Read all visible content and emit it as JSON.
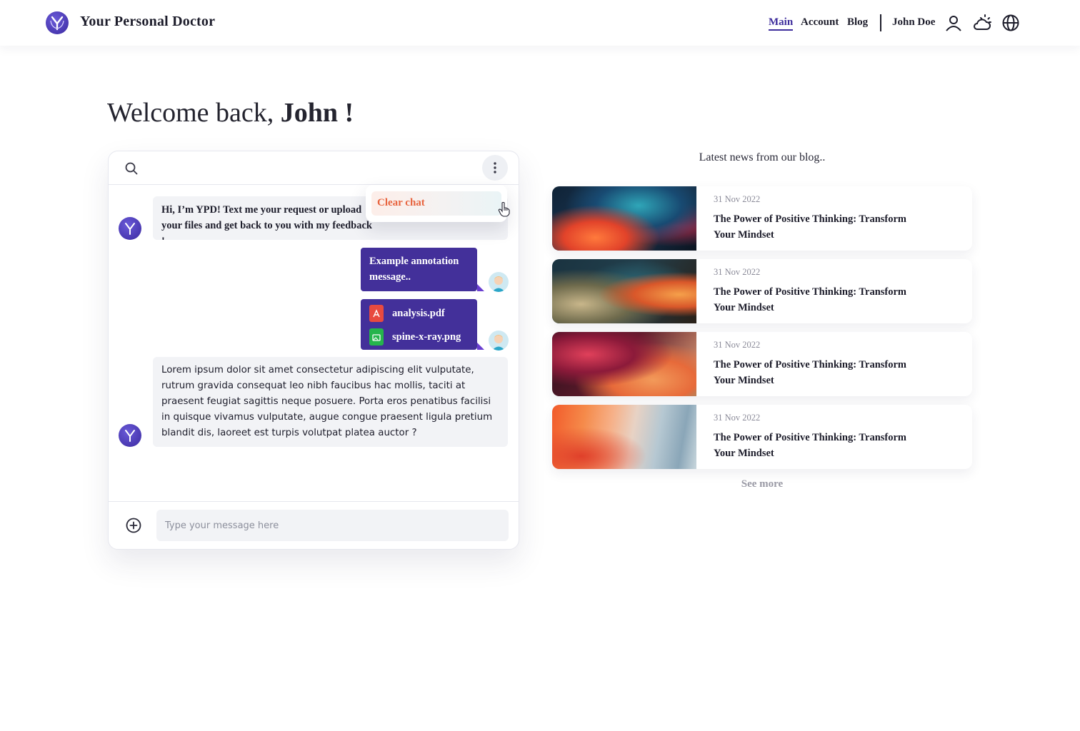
{
  "header": {
    "brand": "Your Personal Doctor",
    "nav": [
      {
        "label": "Main",
        "active": true
      },
      {
        "label": "Account",
        "active": false
      },
      {
        "label": "Blog",
        "active": false
      }
    ],
    "user_name": "John Doe",
    "icons": [
      "user-icon",
      "weather-icon",
      "globe-icon"
    ]
  },
  "welcome": {
    "prefix": "Welcome back,",
    "name": "John !"
  },
  "chat": {
    "menu": {
      "clear_chat": "Clear chat"
    },
    "messages": [
      {
        "from": "bot",
        "text": "Hi, I’m YPD! Text me your request or upload your files and get back to you with my feedback !"
      },
      {
        "from": "user",
        "text": "Example annotation message.."
      },
      {
        "from": "user",
        "files": [
          "analysis.pdf",
          "spine-x-ray.png"
        ]
      },
      {
        "from": "bot",
        "text": "Lorem ipsum dolor sit amet consectetur adipiscing elit vulputate, rutrum gravida consequat leo nibh faucibus hac mollis, taciti at praesent feugiat sagittis neque posuere. Porta eros penatibus facilisi in quisque vivamus vulputate, augue congue praesent ligula pretium blandit dis, laoreet est turpis volutpat platea auctor ?"
      }
    ],
    "input": {
      "placeholder": "Type your message here",
      "value": ""
    }
  },
  "blog": {
    "title": "Latest news from our blog..",
    "posts": [
      {
        "date": "31 Nov 2022",
        "title": "The Power of Positive Thinking: Transform Your Mindset"
      },
      {
        "date": "31 Nov 2022",
        "title": "The Power of Positive Thinking: Transform Your Mindset"
      },
      {
        "date": "31 Nov 2022",
        "title": "The Power of Positive Thinking: Transform Your Mindset"
      },
      {
        "date": "31 Nov 2022",
        "title": "The Power of Positive Thinking: Transform Your Mindset"
      }
    ],
    "see_more": "See more"
  },
  "colors": {
    "accent": "#43309a",
    "danger": "#e8643f",
    "muted": "#9a9aa5"
  }
}
